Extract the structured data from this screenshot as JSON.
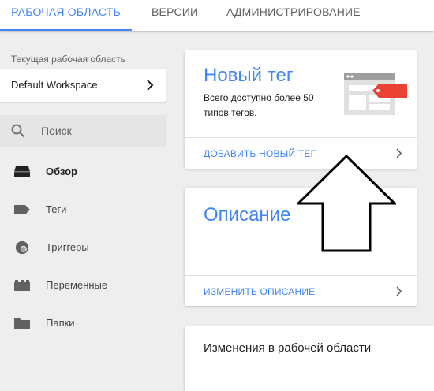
{
  "tabs": [
    {
      "label": "РАБОЧАЯ ОБЛАСТЬ",
      "active": true
    },
    {
      "label": "ВЕРСИИ",
      "active": false
    },
    {
      "label": "АДМИНИСТРИРОВАНИЕ",
      "active": false
    }
  ],
  "sidebar": {
    "workspace_label": "Текущая рабочая область",
    "workspace_name": "Default Workspace",
    "search_placeholder": "Поиск",
    "items": [
      {
        "label": "Обзор",
        "icon": "overview-icon",
        "active": true
      },
      {
        "label": "Теги",
        "icon": "tag-icon",
        "active": false
      },
      {
        "label": "Триггеры",
        "icon": "trigger-icon",
        "active": false
      },
      {
        "label": "Переменные",
        "icon": "variables-icon",
        "active": false
      },
      {
        "label": "Папки",
        "icon": "folder-icon",
        "active": false
      }
    ]
  },
  "cards": {
    "new_tag": {
      "title": "Новый тег",
      "description": "Всего доступно более 50 типов тегов.",
      "action": "ДОБАВИТЬ НОВЫЙ ТЕГ"
    },
    "description": {
      "title": "Описание",
      "action": "ИЗМЕНИТЬ ОПИСАНИЕ"
    },
    "changes": {
      "title": "Изменения в рабочей области"
    }
  },
  "colors": {
    "accent": "#4285f4",
    "tag_red": "#ea4335",
    "background": "#eeeeee"
  }
}
